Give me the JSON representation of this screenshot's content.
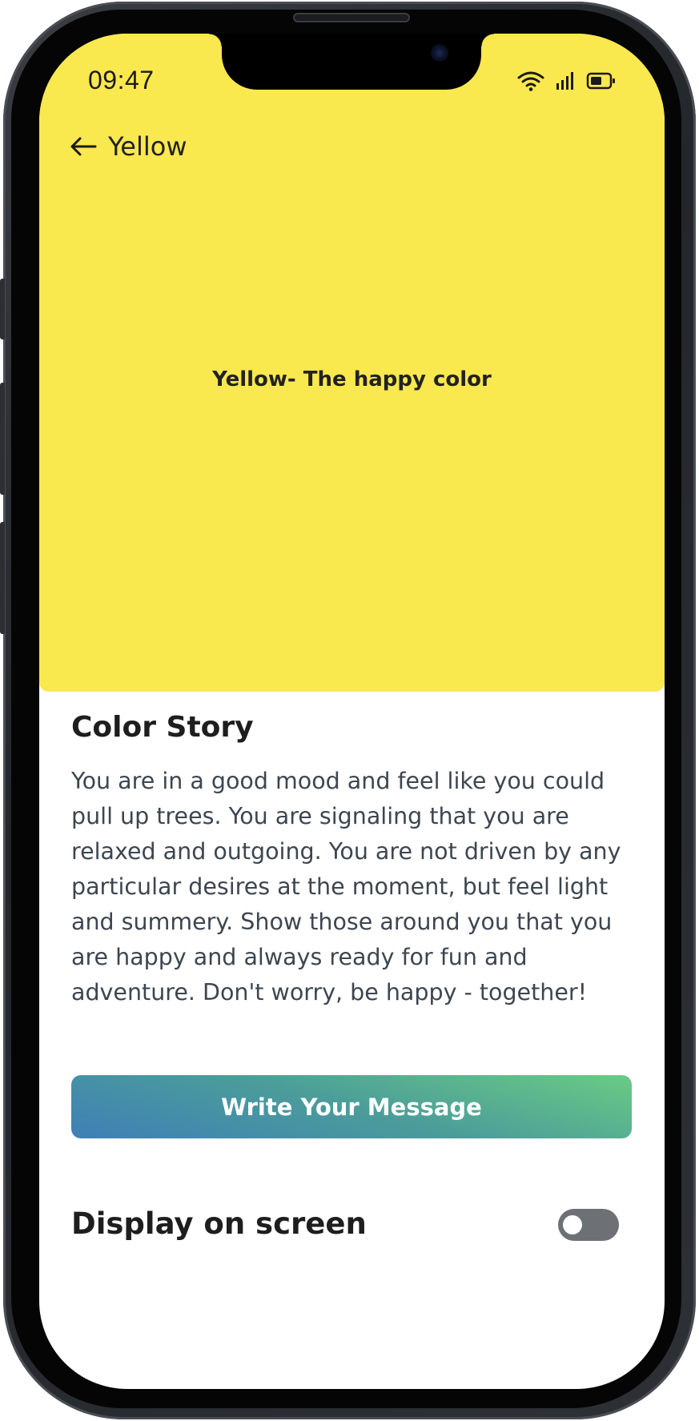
{
  "status_bar": {
    "time": "09:47",
    "icons": [
      "wifi-icon",
      "cellular-signal-icon",
      "battery-icon"
    ]
  },
  "header": {
    "back_icon": "arrow-left-icon",
    "title": "Yellow"
  },
  "hero": {
    "title": "Yellow- The happy color",
    "background_color": "#fae84f"
  },
  "color_story": {
    "heading": "Color Story",
    "body": "You are in a good mood and feel like you could pull up trees. You are signaling that you are relaxed and outgoing. You are not driven by any particular desires at the moment, but feel light and summery. Show those around you that you are happy and always ready for fun and adventure. Don't worry, be happy - together!"
  },
  "actions": {
    "write_message_label": "Write Your Message",
    "button_gradient": [
      "#6acb84",
      "#3f7fb7"
    ]
  },
  "display_setting": {
    "label": "Display on screen",
    "enabled": false
  }
}
